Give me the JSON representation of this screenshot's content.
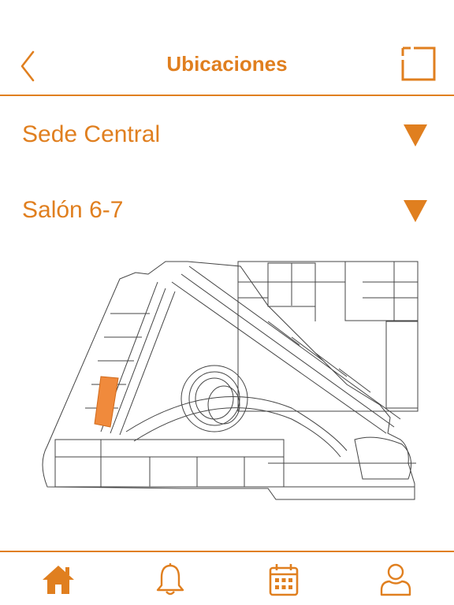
{
  "header": {
    "title": "Ubicaciones",
    "back_icon": "chevron-left-icon",
    "expand_icon": "expand-frame-icon"
  },
  "selectors": {
    "site": {
      "value": "Sede Central",
      "icon": "caret-down-icon"
    },
    "room": {
      "value": "Salón 6-7",
      "icon": "caret-down-icon"
    }
  },
  "map": {
    "highlight_color": "#f08a3c"
  },
  "nav": {
    "items": [
      {
        "icon": "home-icon",
        "active": true
      },
      {
        "icon": "bell-icon",
        "active": false
      },
      {
        "icon": "calendar-icon",
        "active": false
      },
      {
        "icon": "user-icon",
        "active": false
      }
    ]
  },
  "colors": {
    "accent": "#e07f1f",
    "background": "#ffffff",
    "map_lines": "#444444"
  }
}
